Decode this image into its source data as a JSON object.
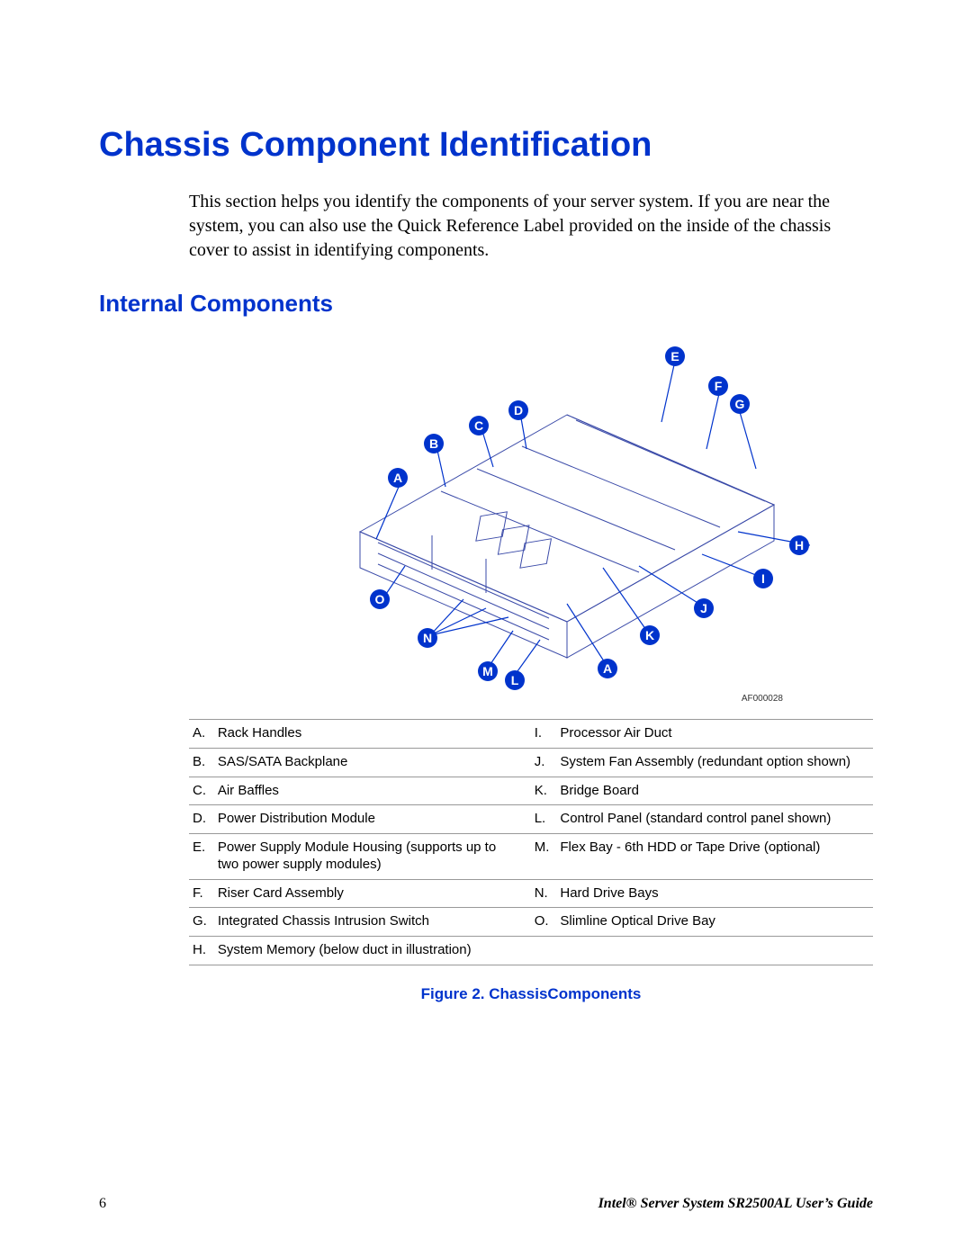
{
  "heading1": "Chassis Component Identification",
  "intro": "This section helps you identify the components of your server system. If you are near the system, you can also use the Quick Reference Label provided on the inside of the chassis cover to assist in identifying components.",
  "heading2": "Internal Components",
  "figure_code": "AF000028",
  "caption": "Figure 2. ChassisComponents",
  "callouts": [
    "A",
    "B",
    "C",
    "D",
    "E",
    "F",
    "G",
    "H",
    "I",
    "J",
    "K",
    "L",
    "M",
    "N",
    "O",
    "A"
  ],
  "legend_left": [
    {
      "letter": "A.",
      "desc": "Rack Handles"
    },
    {
      "letter": "B.",
      "desc": "SAS/SATA Backplane"
    },
    {
      "letter": "C.",
      "desc": "Air Baffles"
    },
    {
      "letter": "D.",
      "desc": "Power Distribution Module"
    },
    {
      "letter": "E.",
      "desc": "Power Supply Module Housing (supports up to two power supply modules)"
    },
    {
      "letter": "F.",
      "desc": "Riser Card Assembly"
    },
    {
      "letter": "G.",
      "desc": "Integrated Chassis Intrusion Switch"
    },
    {
      "letter": "H.",
      "desc": "System Memory (below duct in illustration)"
    }
  ],
  "legend_right": [
    {
      "letter": "I.",
      "desc": "Processor Air Duct"
    },
    {
      "letter": "J.",
      "desc": "System Fan Assembly (redundant option shown)"
    },
    {
      "letter": "K.",
      "desc": "Bridge Board"
    },
    {
      "letter": "L.",
      "desc": "Control Panel (standard control panel shown)"
    },
    {
      "letter": "M.",
      "desc": "Flex Bay - 6th HDD or Tape Drive (optional)"
    },
    {
      "letter": "N.",
      "desc": "Hard Drive Bays"
    },
    {
      "letter": "O.",
      "desc": "Slimline Optical Drive Bay"
    },
    {
      "letter": "",
      "desc": ""
    }
  ],
  "footer": {
    "page": "6",
    "guide": "Intel® Server System SR2500AL User’s Guide"
  }
}
